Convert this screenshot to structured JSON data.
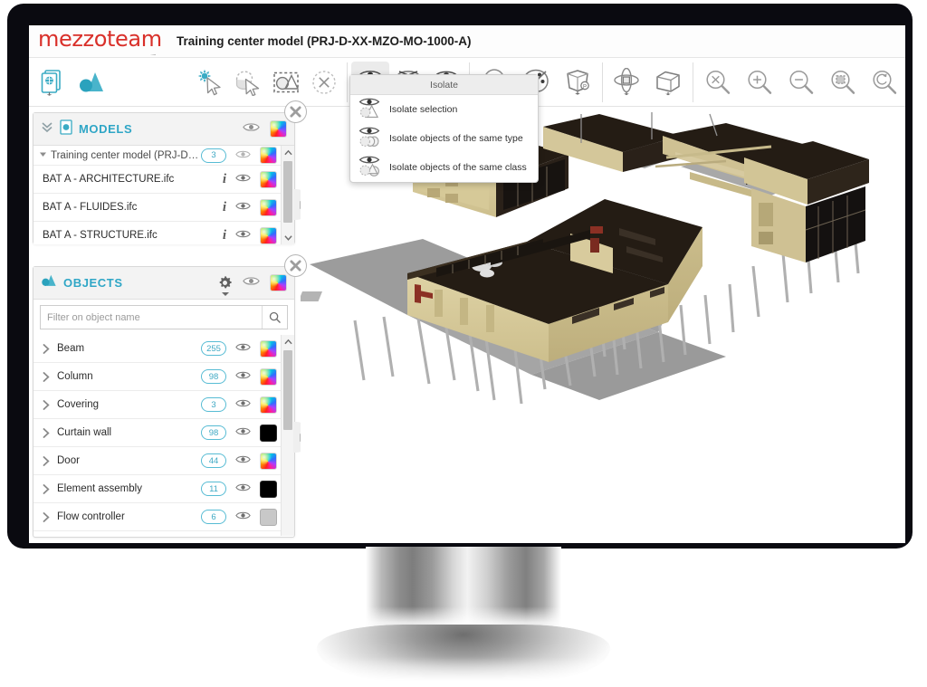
{
  "app": {
    "logo_text": "mezzoteam",
    "title": "Training center model (PRJ-D-XX-MZO-MO-1000-A)"
  },
  "toolbar": {
    "groups": [
      {
        "name": "documents",
        "buttons": [
          {
            "id": "document-viewer",
            "icon": "document-model-icon",
            "label": "Documents",
            "active": false,
            "caret": true
          },
          {
            "id": "model-tree",
            "icon": "model-shapes-icon",
            "label": "Model",
            "active": false,
            "caret": false
          }
        ]
      },
      {
        "name": "selection",
        "buttons": [
          {
            "id": "select-pick",
            "icon": "magic-wand-cursor-icon",
            "label": "Select",
            "active": false,
            "caret": false
          },
          {
            "id": "select-lasso",
            "icon": "lasso-cursor-icon",
            "label": "Lasso select",
            "active": false,
            "caret": false
          },
          {
            "id": "select-rectangle",
            "icon": "rectangle-select-icon",
            "label": "Rectangle select",
            "active": false,
            "caret": false
          },
          {
            "id": "clear-selection",
            "icon": "clear-selection-icon",
            "label": "Clear selection",
            "active": false,
            "caret": false
          }
        ]
      },
      {
        "name": "visibility",
        "buttons": [
          {
            "id": "isolate",
            "icon": "isolate-eye-icon",
            "label": "Isolate",
            "active": true,
            "caret": true
          },
          {
            "id": "hide",
            "icon": "hide-eye-icon",
            "label": "Hide",
            "active": false,
            "caret": true
          },
          {
            "id": "show",
            "icon": "show-eye-icon",
            "label": "Show",
            "active": false,
            "caret": false
          }
        ]
      },
      {
        "name": "appearance",
        "buttons": [
          {
            "id": "transparency",
            "icon": "sphere-transparency-icon",
            "label": "Transparency",
            "active": false,
            "caret": true
          },
          {
            "id": "colors",
            "icon": "palette-icon",
            "label": "Colors",
            "active": false,
            "caret": true
          },
          {
            "id": "render-mode",
            "icon": "cube-render-icon",
            "label": "Render mode",
            "active": false,
            "caret": true
          }
        ]
      },
      {
        "name": "navigation",
        "buttons": [
          {
            "id": "pan-orbit",
            "icon": "pan-arrows-icon",
            "label": "Pan / orbit",
            "active": false,
            "caret": true
          },
          {
            "id": "view-cube",
            "icon": "view-cube-icon",
            "label": "View cube",
            "active": false,
            "caret": true
          }
        ]
      },
      {
        "name": "zoom",
        "buttons": [
          {
            "id": "zoom-drag",
            "icon": "zoom-cross-icon",
            "label": "Zoom",
            "active": false,
            "caret": false
          },
          {
            "id": "zoom-in",
            "icon": "zoom-in-icon",
            "label": "Zoom in",
            "active": false,
            "caret": false
          },
          {
            "id": "zoom-out",
            "icon": "zoom-out-icon",
            "label": "Zoom out",
            "active": false,
            "caret": false
          },
          {
            "id": "zoom-window",
            "icon": "zoom-window-icon",
            "label": "Zoom window",
            "active": false,
            "caret": false
          },
          {
            "id": "zoom-reset",
            "icon": "zoom-reset-icon",
            "label": "Zoom to fit",
            "active": false,
            "caret": false
          }
        ]
      }
    ]
  },
  "isolate_menu": {
    "title": "Isolate",
    "items": [
      {
        "icon": "isolate-selection-icon",
        "label": "Isolate selection"
      },
      {
        "icon": "isolate-same-type-icon",
        "label": "Isolate objects of the same type"
      },
      {
        "icon": "isolate-same-class-icon",
        "label": "Isolate objects of the same class"
      }
    ]
  },
  "models_panel": {
    "title": "MODELS",
    "rows": [
      {
        "name": "Training center model (PRJ-D-XX...",
        "badge": "3",
        "info": false,
        "swatch": "rainbow",
        "top": true
      },
      {
        "name": "BAT A - ARCHITECTURE.ifc",
        "badge": "",
        "info": true,
        "swatch": "rainbow",
        "top": false
      },
      {
        "name": "BAT A - FLUIDES.ifc",
        "badge": "",
        "info": true,
        "swatch": "rainbow",
        "top": false
      },
      {
        "name": "BAT A - STRUCTURE.ifc",
        "badge": "",
        "info": true,
        "swatch": "rainbow",
        "top": false
      }
    ]
  },
  "objects_panel": {
    "title": "OBJECTS",
    "filter_placeholder": "Filter on object name",
    "filter_value": "",
    "rows": [
      {
        "name": "Beam",
        "badge": "255",
        "swatch": "rainbow"
      },
      {
        "name": "Column",
        "badge": "98",
        "swatch": "rainbow"
      },
      {
        "name": "Covering",
        "badge": "3",
        "swatch": "rainbow"
      },
      {
        "name": "Curtain wall",
        "badge": "98",
        "swatch": "black"
      },
      {
        "name": "Door",
        "badge": "44",
        "swatch": "rainbow"
      },
      {
        "name": "Element assembly",
        "badge": "11",
        "swatch": "black"
      },
      {
        "name": "Flow controller",
        "badge": "6",
        "swatch": "gray"
      }
    ]
  },
  "colors": {
    "brand_teal": "#2fa6c6",
    "logo_red": "#d9302a",
    "badge_border": "#57bcd4",
    "bezel": "#0a0a10"
  }
}
